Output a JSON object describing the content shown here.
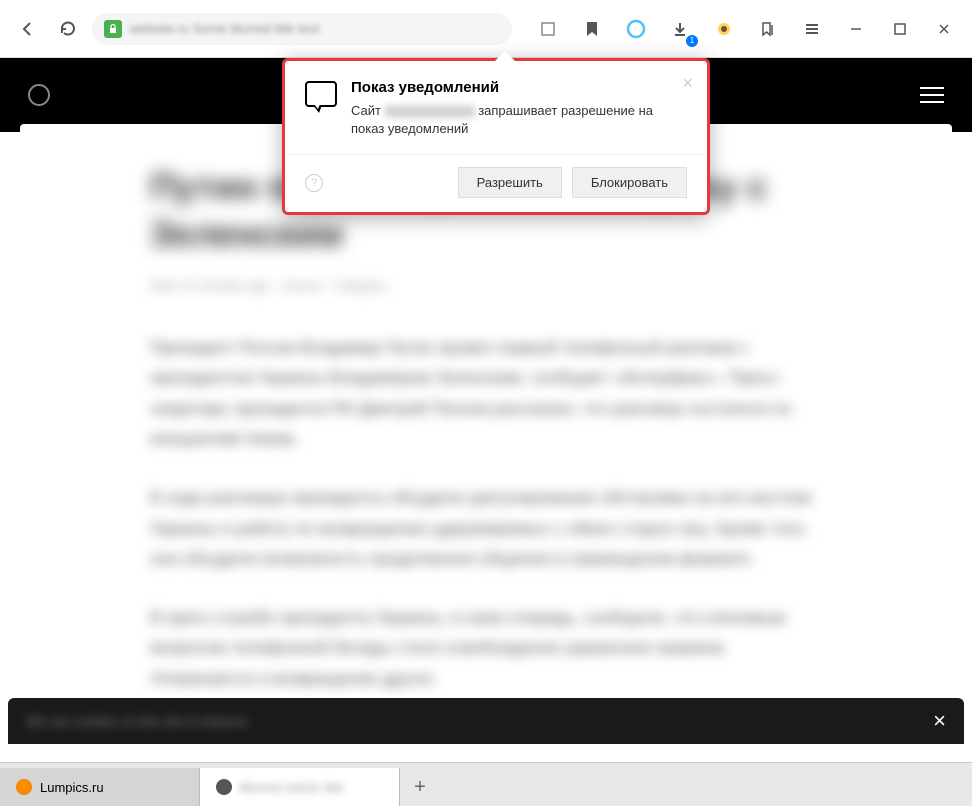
{
  "toolbar": {
    "url_blur": "website.ru  Some blurred title text",
    "download_badge": "1"
  },
  "dialog": {
    "title": "Показ уведомлений",
    "desc_prefix": "Сайт ",
    "desc_suffix": " запрашивает разрешение на показ уведомлений",
    "allow": "Разрешить",
    "block": "Блокировать",
    "help": "?",
    "close": "×"
  },
  "page": {
    "title_blur": "Путин переговорил по телефону с Зеленским",
    "meta_blur": "Date 15 minutes ago · Source · Category",
    "para1": "Президент России Владимир Путин провел первый телефонный разговор с президентом Украины Владимиром Зеленским, сообщает «Интерфакс». Пресс-секретарь президента РФ Дмитрий Песков рассказал, что разговор состоялся по инициативе Киева.",
    "para2": "В ходе разговора президенты обсудили урегулирование обстановки на юго-востоке Украины и работу по возвращению удерживаемых с обеих сторон лиц. Кроме того, они обсудили возможность продолжения общения в нормандском формате.",
    "para3": "В пресс-службе президента Украины, в свою очередь, сообщили, что ключевым вопросом телефонной беседы стало освобождение украинских моряков. Упоминается и возвращение других"
  },
  "cookie": {
    "text_blur": "We use cookies on this site to improve",
    "close": "×"
  },
  "tabs": {
    "tab1_label": "Lumpics.ru",
    "tab2_label": "Blurred article title",
    "add": "+"
  }
}
